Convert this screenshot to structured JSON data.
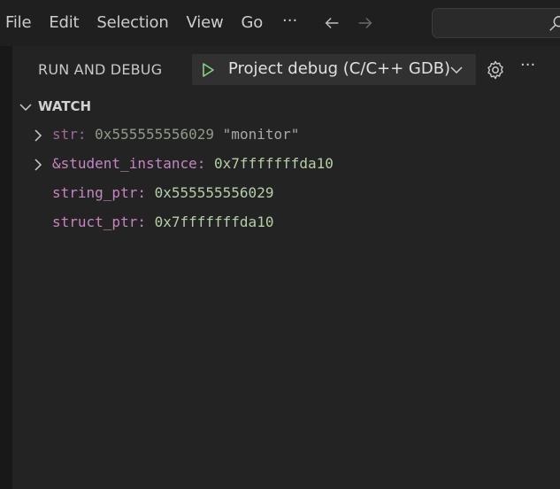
{
  "menu": {
    "items": [
      "File",
      "Edit",
      "Selection",
      "View",
      "Go"
    ],
    "more": "···"
  },
  "search": {
    "placeholder": ""
  },
  "debug_panel": {
    "title": "RUN AND DEBUG",
    "configuration": "Project debug (C/C++ GDB)"
  },
  "watch": {
    "title": "WATCH",
    "items": [
      {
        "name": "str",
        "value": "0x555555556029",
        "string": "\"monitor\"",
        "expandable": true
      },
      {
        "name": "&student_instance",
        "value": "0x7fffffffda10",
        "expandable": true
      },
      {
        "name": "string_ptr",
        "value": "0x555555556029",
        "expandable": false
      },
      {
        "name": "struct_ptr",
        "value": "0x7fffffffda10",
        "expandable": false
      }
    ]
  },
  "icons": {
    "back": "arrow-left-icon",
    "forward": "arrow-right-icon",
    "search": "search-icon",
    "start": "play-icon",
    "config": "gear-icon"
  },
  "colors": {
    "variable_name": "#c586c0",
    "variable_value": "#b5cea8",
    "start_icon": "#89d185"
  }
}
